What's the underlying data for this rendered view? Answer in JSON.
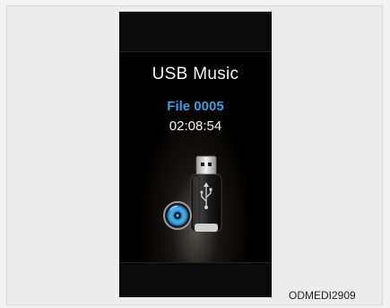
{
  "screen": {
    "title": "USB Music",
    "file_label": "File 0005",
    "elapsed_time": "02:08:54"
  },
  "graphic": {
    "icon": "usb-flash-drive-icon",
    "badge_icon": "disc-icon",
    "accent_color": "#3c9ce0"
  },
  "caption": "ODMEDI2909"
}
